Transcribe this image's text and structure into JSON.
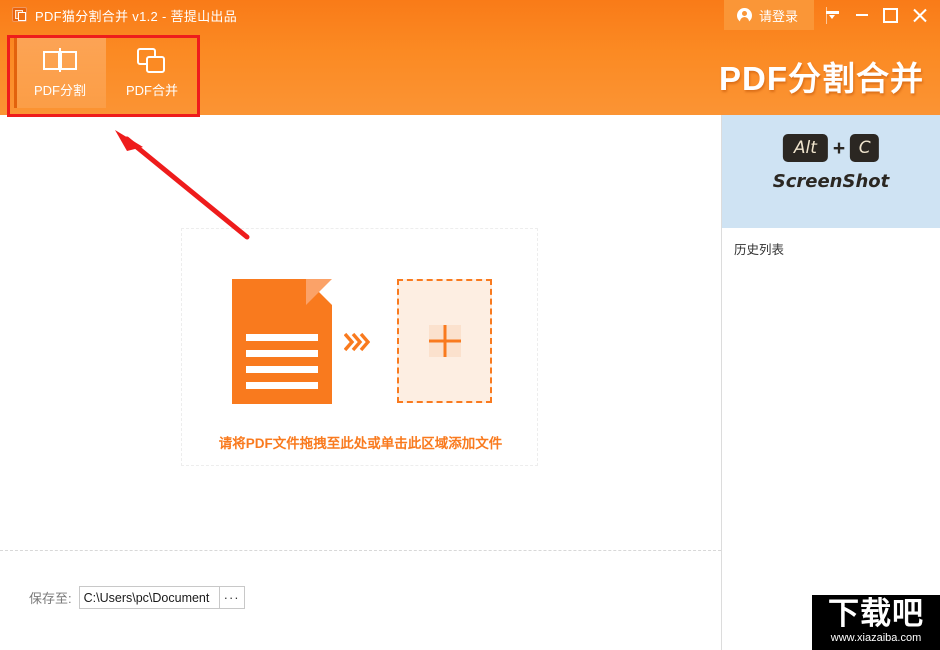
{
  "window": {
    "title": "PDF猫分割合并 v1.2 - 菩提山出品",
    "app_icon": "pdf-app-icon",
    "login_label": "请登录",
    "login_icon": "user-avatar-icon",
    "controls": {
      "menu_icon": "menu-caret-icon",
      "minimize_icon": "minimize-icon",
      "maximize_icon": "maximize-icon",
      "close_icon": "close-icon"
    }
  },
  "header": {
    "brand": "PDF分割合并",
    "background_color": "#fb8a23",
    "tabs": [
      {
        "label": "PDF分割",
        "icon": "split-icon",
        "active": true
      },
      {
        "label": "PDF合并",
        "icon": "merge-icon",
        "active": false
      }
    ]
  },
  "main": {
    "dropzone": {
      "hint": "请将PDF文件拖拽至此处或单击此区域添加文件",
      "hint_color": "#f97a1e",
      "document_icon": "pdf-document-icon",
      "arrow_icon": "triple-chevron-icon",
      "add_icon": "plus-icon"
    },
    "save": {
      "label": "保存至:",
      "path": "C:\\Users\\pc\\Document",
      "browse_label": "···"
    }
  },
  "right_panel": {
    "screenshot_banner": {
      "key_1": "Alt",
      "plus": "+",
      "key_2": "C",
      "caption": "ScreenShot",
      "background_color": "#cfe3f3"
    },
    "history_title": "历史列表"
  },
  "annotations": {
    "highlight_color": "#ee1c1c",
    "rect_target": "toolbar-tabs",
    "arrow_target": "toolbar-tabs"
  },
  "watermark": {
    "name": "下载吧",
    "url": "www.xiazaiba.com"
  }
}
